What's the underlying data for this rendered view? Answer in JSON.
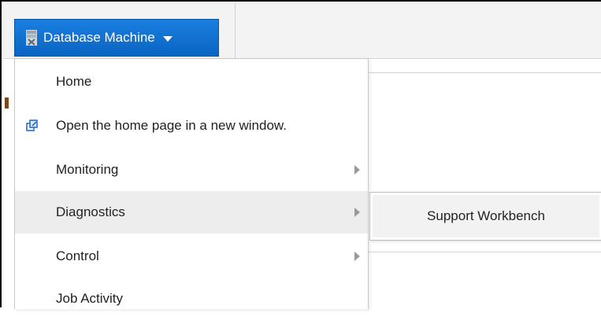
{
  "toolbar": {
    "target_menu_label": "Database Machine",
    "icon": "database-icon",
    "chevron_icon": "chevron-down-icon"
  },
  "menu": {
    "items": [
      {
        "label": "Home",
        "has_submenu": false
      },
      {
        "label": "Open the home page in a new window.",
        "icon": "new-window-icon",
        "has_submenu": false
      },
      {
        "label": "Monitoring",
        "has_submenu": true
      },
      {
        "label": "Diagnostics",
        "has_submenu": true,
        "active": true
      },
      {
        "label": "Control",
        "has_submenu": true
      },
      {
        "label": "Job Activity",
        "has_submenu": false
      }
    ]
  },
  "submenu": {
    "items": [
      {
        "label": "Support Workbench"
      }
    ]
  },
  "colors": {
    "accent": "#0b6fd4",
    "menu_highlight": "#ededed",
    "submenu_highlight": "#f2f2f2",
    "text": "#222222"
  }
}
